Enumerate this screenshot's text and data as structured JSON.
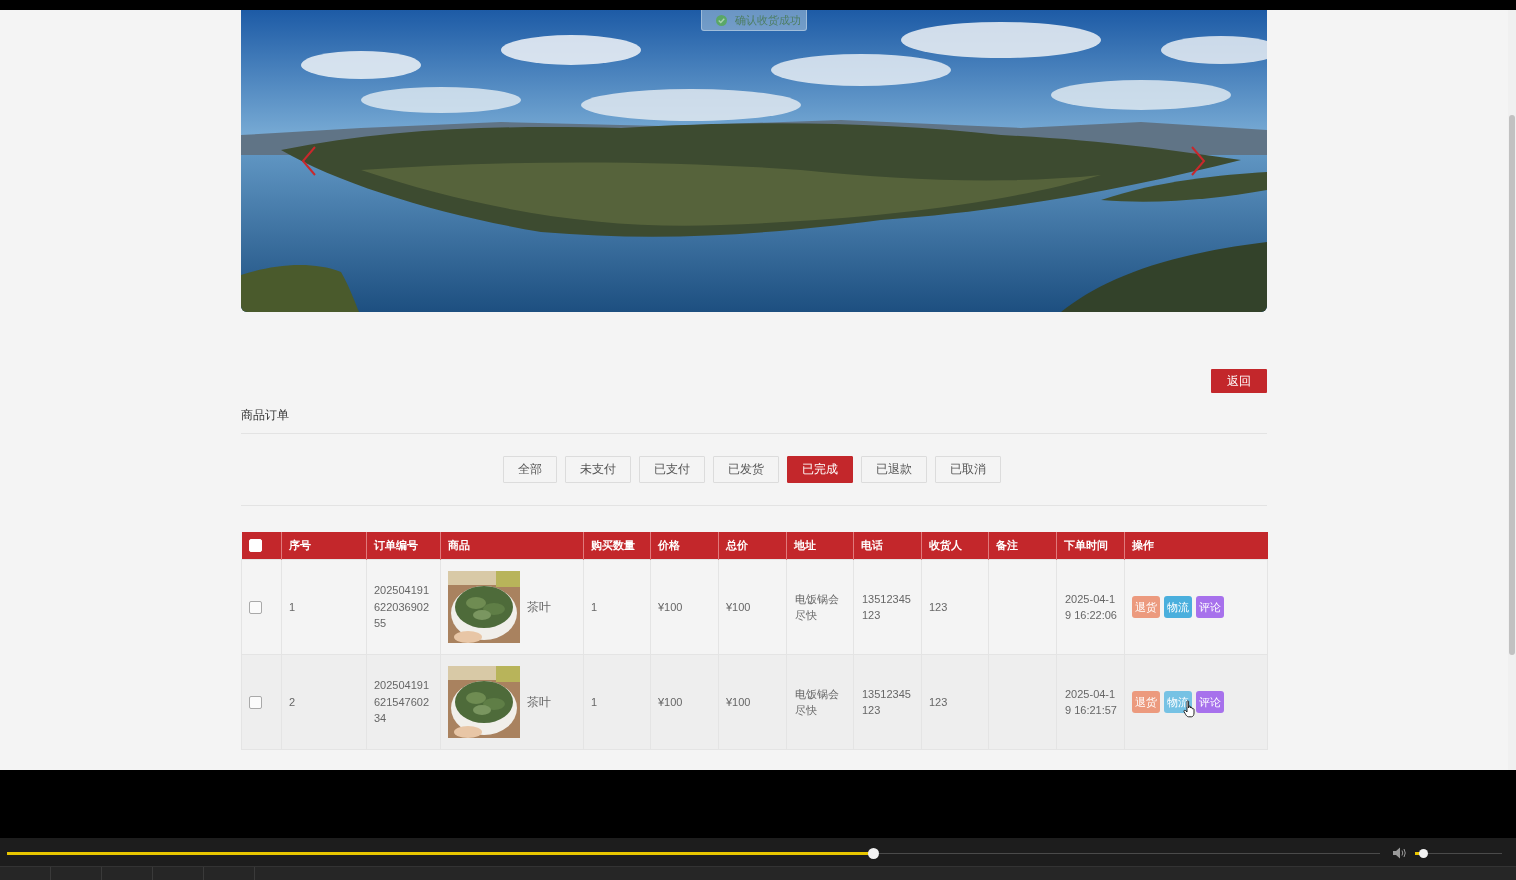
{
  "toast": {
    "text": "确认收货成功"
  },
  "back_button": "返回",
  "section_title": "商品订单",
  "tabs": [
    {
      "label": "全部",
      "selected": false
    },
    {
      "label": "未支付",
      "selected": false
    },
    {
      "label": "已支付",
      "selected": false
    },
    {
      "label": "已发货",
      "selected": false
    },
    {
      "label": "已完成",
      "selected": true
    },
    {
      "label": "已退款",
      "selected": false
    },
    {
      "label": "已取消",
      "selected": false
    }
  ],
  "table": {
    "select_all_checked": false,
    "columns": [
      "序号",
      "订单编号",
      "商品",
      "购买数量",
      "价格",
      "总价",
      "地址",
      "电话",
      "收货人",
      "备注",
      "下单时间",
      "操作"
    ],
    "rows": [
      {
        "checked": false,
        "index": "1",
        "order_no": "20250419162203690255",
        "product": "茶叶",
        "quantity": "1",
        "price": "¥100",
        "total": "¥100",
        "address": "电饭锅会尽快",
        "phone": "13512345123",
        "consignee": "123",
        "order_time": "2025-04-19 16:22:06",
        "actions": [
          {
            "label": "退货",
            "color": "#ec9a7e",
            "hovered": false
          },
          {
            "label": "物流",
            "color": "#4aafdd",
            "hovered": false
          },
          {
            "label": "评论",
            "color": "#a771ec",
            "hovered": false
          }
        ]
      },
      {
        "checked": false,
        "index": "2",
        "order_no": "20250419162154760234",
        "product": "茶叶",
        "quantity": "1",
        "price": "¥100",
        "total": "¥100",
        "address": "电饭锅会尽快",
        "phone": "13512345123",
        "consignee": "123",
        "order_time": "2025-04-19 16:21:57",
        "actions": [
          {
            "label": "退货",
            "color": "#ec9a7e",
            "hovered": false
          },
          {
            "label": "物流",
            "color": "#76c2e4",
            "hovered": true
          },
          {
            "label": "评论",
            "color": "#a771ec",
            "hovered": false
          }
        ]
      }
    ]
  },
  "player": {
    "progress": {
      "level": 0.631
    },
    "volume": {
      "level": 0.08
    }
  }
}
